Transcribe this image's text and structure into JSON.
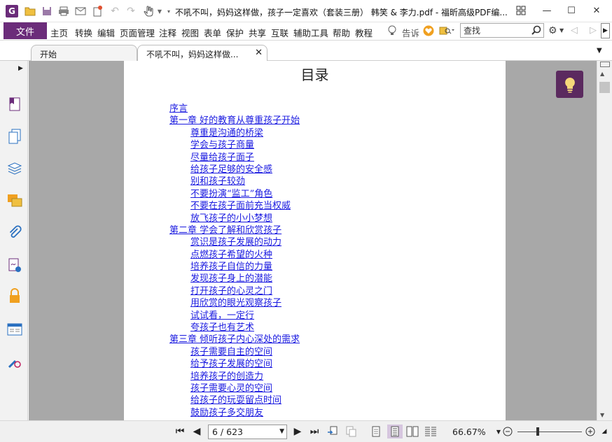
{
  "window": {
    "title": "不吼不叫，妈妈这样做，孩子一定喜欢（套装三册） 韩笑 & 李力.pdf - 福昕高级PDF编...",
    "minimize_glyph": "—",
    "maximize_glyph": "☐",
    "close_glyph": "✕"
  },
  "menubar": {
    "file_label": "文件",
    "items": [
      "主页",
      "转换",
      "编辑",
      "页面管理",
      "注释",
      "视图",
      "表单",
      "保护",
      "共享",
      "互联",
      "辅助工具",
      "帮助",
      "教程"
    ],
    "tell_me": "告诉",
    "search_placeholder": "查找"
  },
  "tabs": [
    {
      "label": "开始"
    },
    {
      "label": "不吼不叫，妈妈这样做..."
    }
  ],
  "document": {
    "heading": "目录",
    "toc": [
      {
        "text": "序言",
        "level": 0
      },
      {
        "text": "第一章 好的教育从尊重孩子开始",
        "level": 0
      },
      {
        "text": "尊重是沟通的桥梁",
        "level": 1
      },
      {
        "text": "学会与孩子商量",
        "level": 1
      },
      {
        "text": "尽量给孩子面子",
        "level": 1
      },
      {
        "text": "给孩子足够的安全感",
        "level": 1
      },
      {
        "text": "别和孩子较劲",
        "level": 1
      },
      {
        "text": "不要扮演“监工”角色",
        "level": 1
      },
      {
        "text": "不要在孩子面前充当权威",
        "level": 1
      },
      {
        "text": "放飞孩子的小小梦想",
        "level": 1
      },
      {
        "text": "第二章 学会了解和欣赏孩子",
        "level": 0
      },
      {
        "text": "赏识是孩子发展的动力",
        "level": 1
      },
      {
        "text": "点燃孩子希望的火种",
        "level": 1
      },
      {
        "text": "培养孩子自信的力量",
        "level": 1
      },
      {
        "text": "发现孩子身上的潜能",
        "level": 1
      },
      {
        "text": "打开孩子的心灵之门",
        "level": 1
      },
      {
        "text": "用欣赏的眼光观察孩子",
        "level": 1
      },
      {
        "text": "试试看，一定行",
        "level": 1
      },
      {
        "text": "夸孩子也有艺术",
        "level": 1
      },
      {
        "text": "第三章 倾听孩子内心深处的需求",
        "level": 0
      },
      {
        "text": "孩子需要自主的空间",
        "level": 1
      },
      {
        "text": "给予孩子发展的空间",
        "level": 1
      },
      {
        "text": "培养孩子的创造力",
        "level": 1
      },
      {
        "text": "孩子需要心灵的空间",
        "level": 1
      },
      {
        "text": "给孩子的玩耍留点时间",
        "level": 1
      },
      {
        "text": "鼓励孩子多交朋友",
        "level": 1
      }
    ]
  },
  "status": {
    "page_indicator": "6 / 623",
    "zoom": "66.67%"
  },
  "colors": {
    "brand": "#6b2c7a",
    "link": "#1a1ae0",
    "canvas": "#a8a8a8",
    "bulb_bg": "#5b2a5f"
  }
}
